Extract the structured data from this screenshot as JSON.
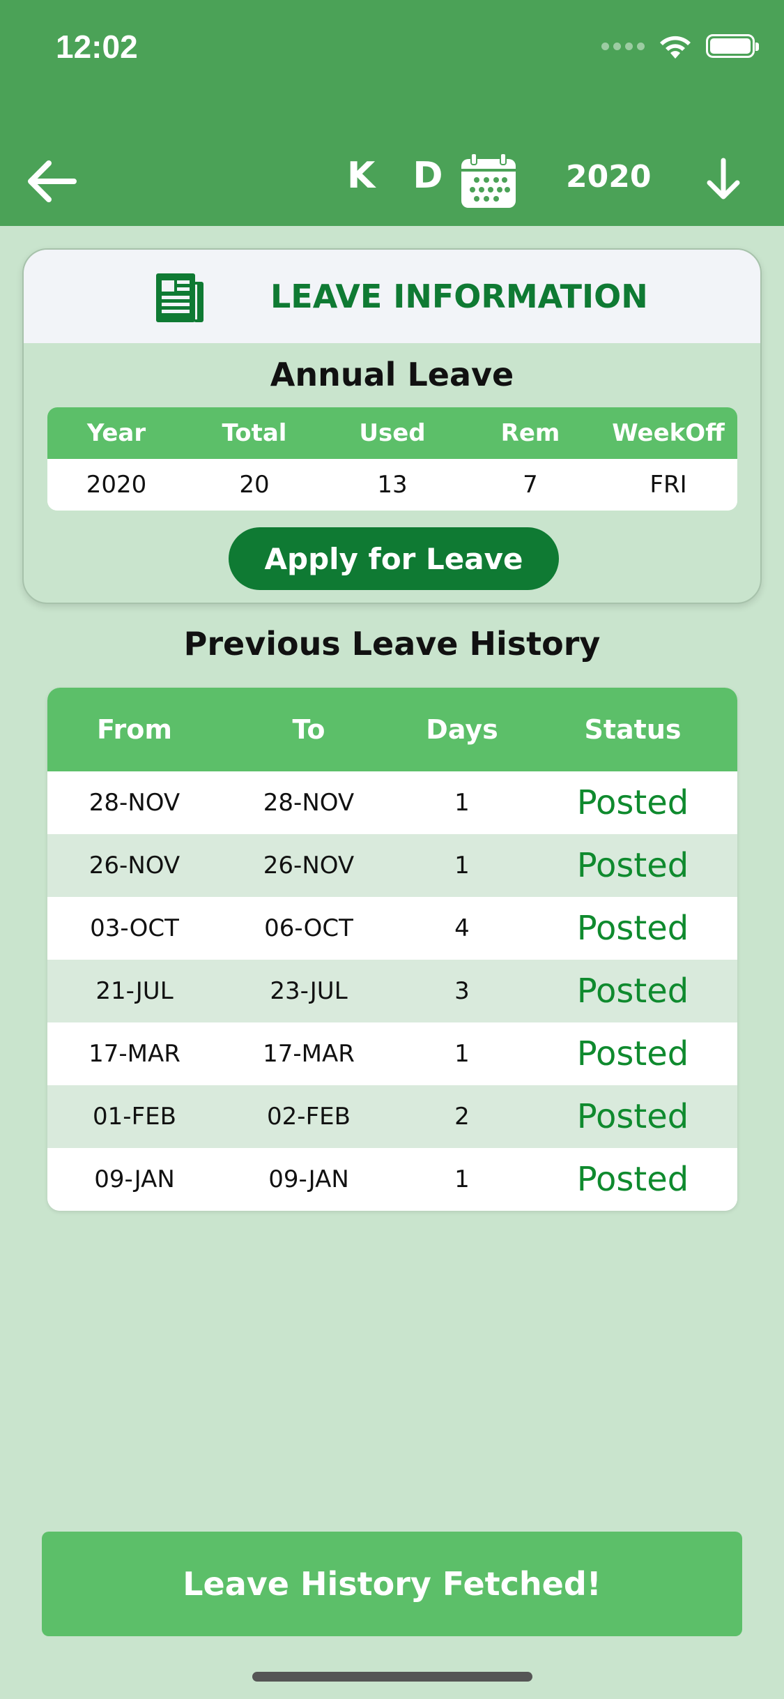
{
  "status_bar": {
    "time": "12:02"
  },
  "header": {
    "title": "K D S",
    "year": "2020",
    "icons": [
      "back-arrow-icon",
      "calendar-icon",
      "download-arrow-icon"
    ]
  },
  "leave_info": {
    "title": "LEAVE INFORMATION",
    "subtitle": "Annual Leave",
    "columns": [
      "Year",
      "Total",
      "Used",
      "Rem",
      "WeekOff"
    ],
    "values": [
      "2020",
      "20",
      "13",
      "7",
      "FRI"
    ],
    "apply_label": "Apply for Leave"
  },
  "history": {
    "title": "Previous Leave History",
    "columns": [
      "From",
      "To",
      "Days",
      "Status"
    ],
    "rows": [
      {
        "from": "28-NOV",
        "to": "28-NOV",
        "days": "1",
        "status": "Posted"
      },
      {
        "from": "26-NOV",
        "to": "26-NOV",
        "days": "1",
        "status": "Posted"
      },
      {
        "from": "03-OCT",
        "to": "06-OCT",
        "days": "4",
        "status": "Posted"
      },
      {
        "from": "21-JUL",
        "to": "23-JUL",
        "days": "3",
        "status": "Posted"
      },
      {
        "from": "17-MAR",
        "to": "17-MAR",
        "days": "1",
        "status": "Posted"
      },
      {
        "from": "01-FEB",
        "to": "02-FEB",
        "days": "2",
        "status": "Posted"
      },
      {
        "from": "09-JAN",
        "to": "09-JAN",
        "days": "1",
        "status": "Posted"
      }
    ]
  },
  "toast": {
    "message": "Leave History Fetched!"
  },
  "colors": {
    "header_green": "#4ba257",
    "background": "#c9e4cd",
    "table_head_green": "#5cbf69",
    "dark_green": "#0f7a33",
    "status_green": "#0f8a2e"
  }
}
